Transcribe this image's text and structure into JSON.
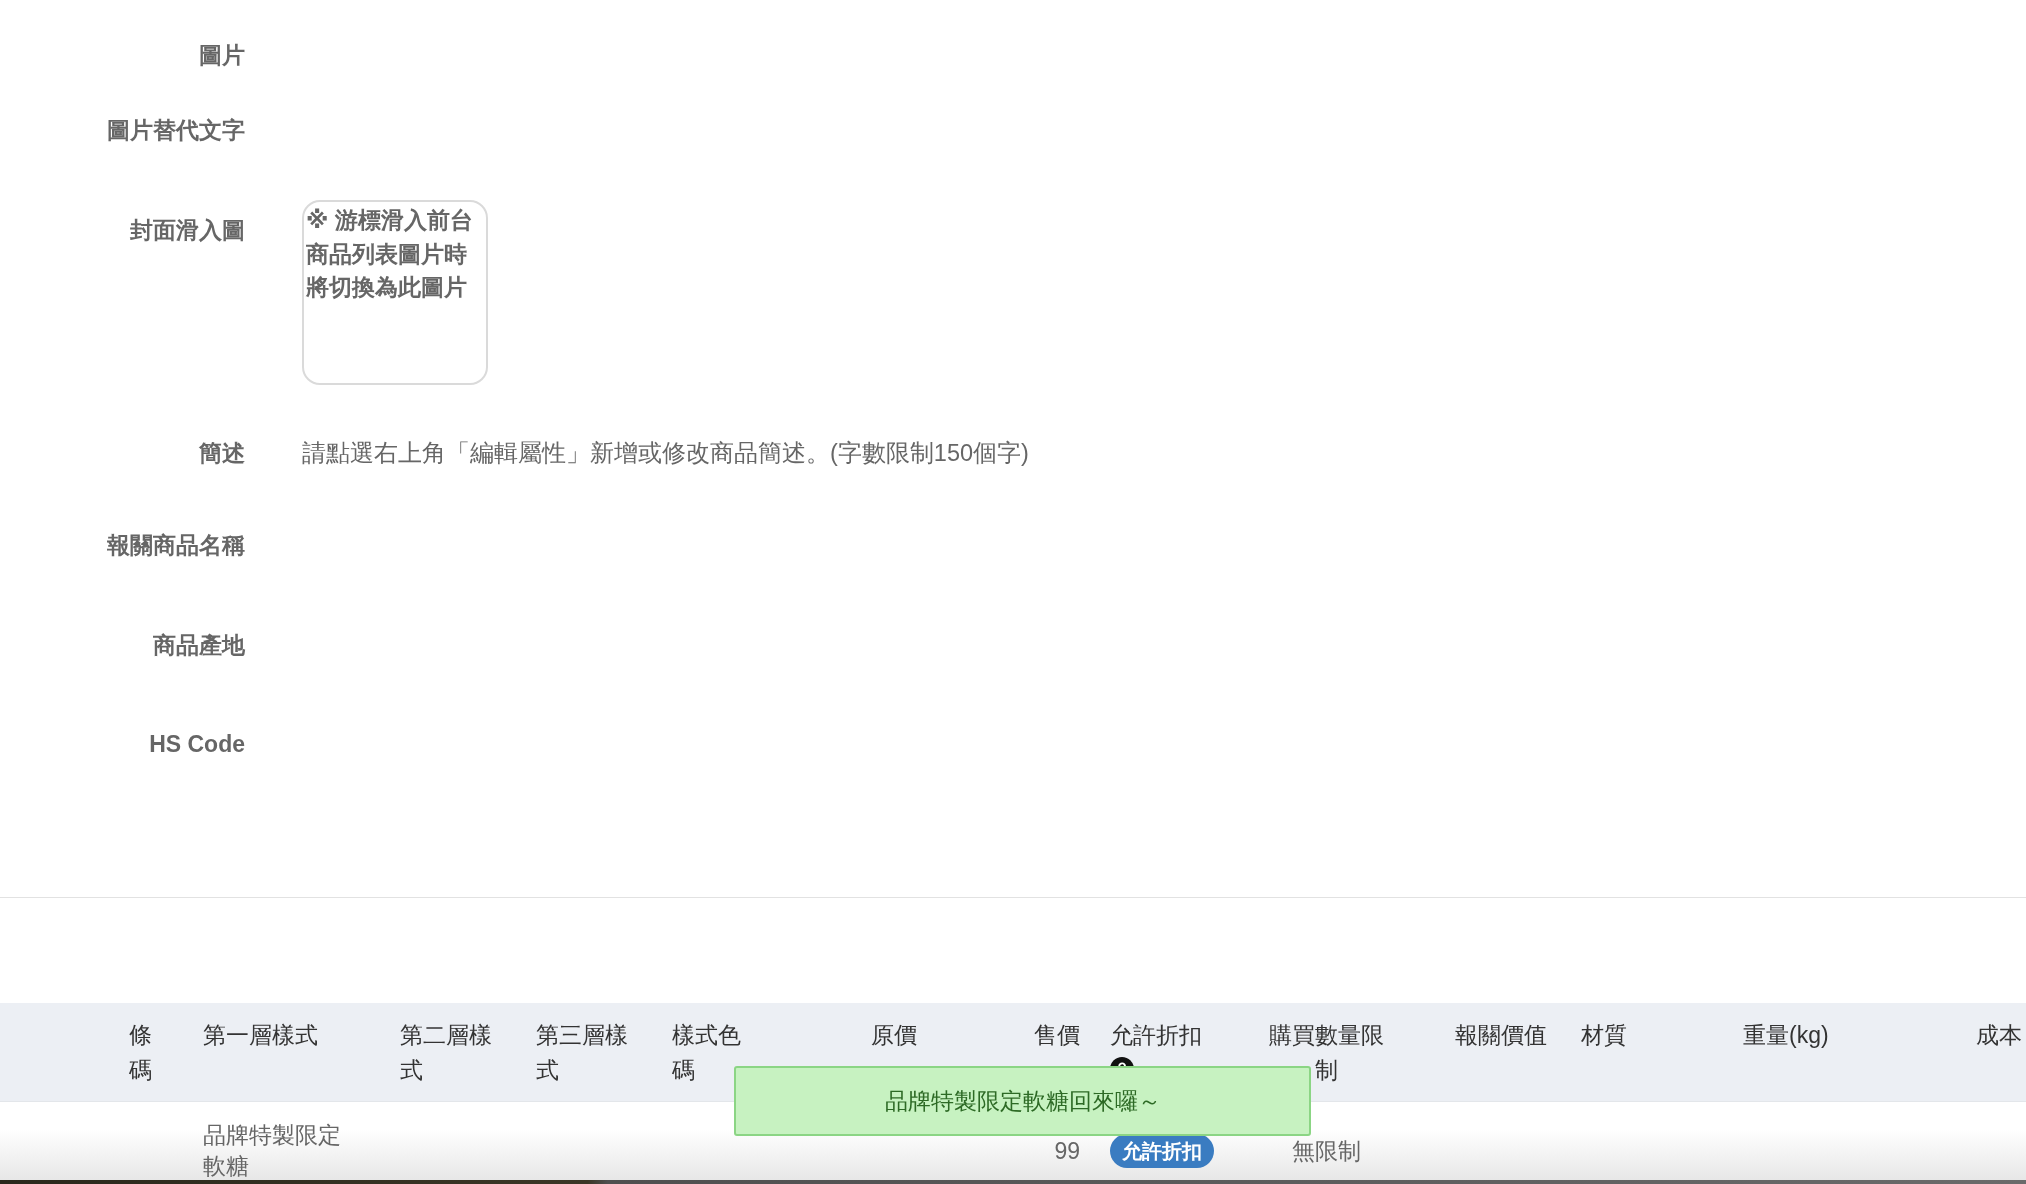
{
  "form": {
    "fields": [
      {
        "label": "圖片",
        "kind": "empty"
      },
      {
        "label": "圖片替代文字",
        "kind": "empty"
      },
      {
        "label": "封面滑入圖",
        "kind": "upload",
        "hint": "※ 游標滑入前台商品列表圖片時將切換為此圖片"
      },
      {
        "label": "簡述",
        "kind": "text",
        "value": "請點選右上角「編輯屬性」新增或修改商品簡述。(字數限制150個字)"
      },
      {
        "label": "報關商品名稱",
        "kind": "empty"
      },
      {
        "label": "商品產地",
        "kind": "empty"
      },
      {
        "label": "HS Code",
        "kind": "empty"
      }
    ]
  },
  "table": {
    "columns": [
      {
        "label": "條碼",
        "help": false
      },
      {
        "label": "第一層樣式",
        "help": false
      },
      {
        "label": "第二層樣式",
        "help": false
      },
      {
        "label": "第三層樣式",
        "help": false
      },
      {
        "label": "樣式色碼",
        "help": false
      },
      {
        "label": "原價",
        "help": false
      },
      {
        "label": "售價",
        "help": false
      },
      {
        "label": "允許折扣",
        "help": true
      },
      {
        "label": "購買數量限制",
        "help": false
      },
      {
        "label": "報關價值",
        "help": false
      },
      {
        "label": "材質",
        "help": false
      },
      {
        "label": "重量(kg)",
        "help": false
      },
      {
        "label": "成本",
        "help": false
      }
    ],
    "rows": [
      {
        "style_1": "品牌特製限定軟糖",
        "price": "99",
        "discount_badge": "允許折扣",
        "purchase_limit": "無限制"
      }
    ]
  },
  "toast": {
    "message": "品牌特製限定軟糖回來囉～"
  }
}
